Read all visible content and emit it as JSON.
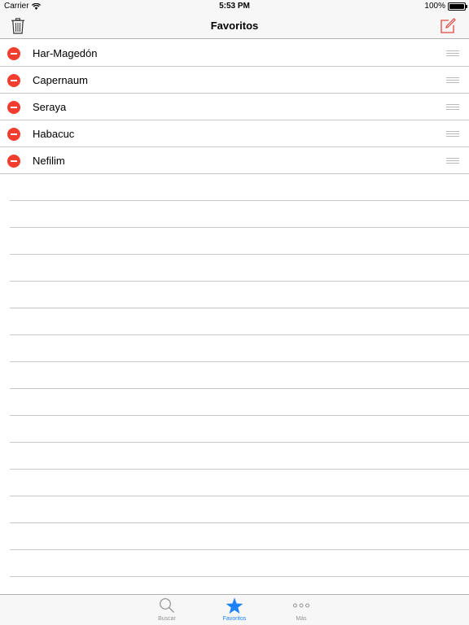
{
  "status_bar": {
    "carrier": "Carrier",
    "time": "5:53 PM",
    "battery": "100%"
  },
  "nav": {
    "title": "Favoritos",
    "left_icon": "trash-icon",
    "right_icon": "compose-icon",
    "accent_color": "#e8453c"
  },
  "favorites": [
    {
      "label": "Har-Magedón"
    },
    {
      "label": "Capernaum"
    },
    {
      "label": "Seraya"
    },
    {
      "label": "Habacuc"
    },
    {
      "label": "Nefilim"
    }
  ],
  "tab_bar": {
    "active_color": "#1a82fb",
    "inactive_color": "#929292",
    "tabs": [
      {
        "label": "Buscar",
        "icon": "search-icon",
        "active": false
      },
      {
        "label": "Favoritos",
        "icon": "star-icon",
        "active": true
      },
      {
        "label": "Más",
        "icon": "more-icon",
        "active": false
      }
    ]
  }
}
